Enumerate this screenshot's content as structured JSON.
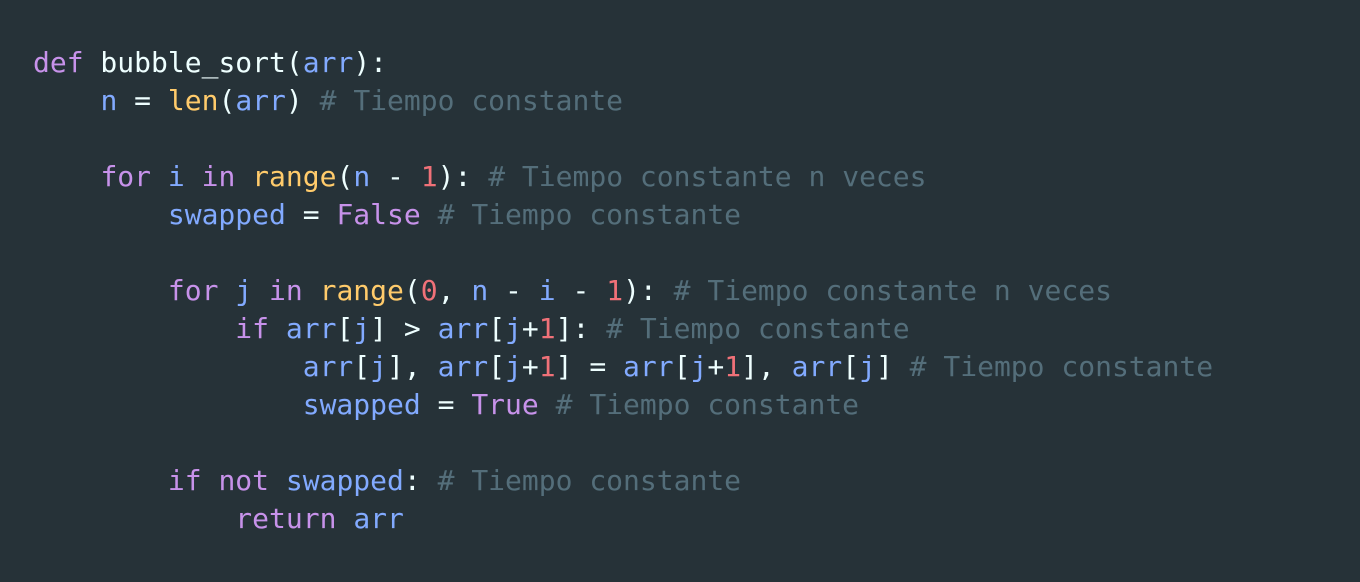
{
  "colors": {
    "background": "#263238",
    "plain": "#eeffff",
    "keyword": "#c792ea",
    "variable": "#82aaff",
    "builtin": "#ffcb6b",
    "number": "#f07178",
    "comment": "#546e7a"
  },
  "code": {
    "language": "python",
    "lines": [
      [
        {
          "t": "def",
          "k": "keyword"
        },
        {
          "t": " bubble_sort(",
          "k": "plain"
        },
        {
          "t": "arr",
          "k": "variable"
        },
        {
          "t": "):",
          "k": "plain"
        }
      ],
      [
        {
          "t": "    ",
          "k": "plain"
        },
        {
          "t": "n",
          "k": "variable"
        },
        {
          "t": " = ",
          "k": "plain"
        },
        {
          "t": "len",
          "k": "builtin"
        },
        {
          "t": "(",
          "k": "plain"
        },
        {
          "t": "arr",
          "k": "variable"
        },
        {
          "t": ") ",
          "k": "plain"
        },
        {
          "t": "# Tiempo constante",
          "k": "comment"
        }
      ],
      [],
      [
        {
          "t": "    ",
          "k": "plain"
        },
        {
          "t": "for",
          "k": "keyword"
        },
        {
          "t": " ",
          "k": "plain"
        },
        {
          "t": "i",
          "k": "variable"
        },
        {
          "t": " ",
          "k": "plain"
        },
        {
          "t": "in",
          "k": "keyword"
        },
        {
          "t": " ",
          "k": "plain"
        },
        {
          "t": "range",
          "k": "builtin"
        },
        {
          "t": "(",
          "k": "plain"
        },
        {
          "t": "n",
          "k": "variable"
        },
        {
          "t": " - ",
          "k": "plain"
        },
        {
          "t": "1",
          "k": "number"
        },
        {
          "t": "): ",
          "k": "plain"
        },
        {
          "t": "# Tiempo constante n veces",
          "k": "comment"
        }
      ],
      [
        {
          "t": "        ",
          "k": "plain"
        },
        {
          "t": "swapped",
          "k": "variable"
        },
        {
          "t": " = ",
          "k": "plain"
        },
        {
          "t": "False",
          "k": "keyword"
        },
        {
          "t": " ",
          "k": "plain"
        },
        {
          "t": "# Tiempo constante",
          "k": "comment"
        }
      ],
      [],
      [
        {
          "t": "        ",
          "k": "plain"
        },
        {
          "t": "for",
          "k": "keyword"
        },
        {
          "t": " ",
          "k": "plain"
        },
        {
          "t": "j",
          "k": "variable"
        },
        {
          "t": " ",
          "k": "plain"
        },
        {
          "t": "in",
          "k": "keyword"
        },
        {
          "t": " ",
          "k": "plain"
        },
        {
          "t": "range",
          "k": "builtin"
        },
        {
          "t": "(",
          "k": "plain"
        },
        {
          "t": "0",
          "k": "number"
        },
        {
          "t": ", ",
          "k": "plain"
        },
        {
          "t": "n",
          "k": "variable"
        },
        {
          "t": " - ",
          "k": "plain"
        },
        {
          "t": "i",
          "k": "variable"
        },
        {
          "t": " - ",
          "k": "plain"
        },
        {
          "t": "1",
          "k": "number"
        },
        {
          "t": "): ",
          "k": "plain"
        },
        {
          "t": "# Tiempo constante n veces",
          "k": "comment"
        }
      ],
      [
        {
          "t": "            ",
          "k": "plain"
        },
        {
          "t": "if",
          "k": "keyword"
        },
        {
          "t": " ",
          "k": "plain"
        },
        {
          "t": "arr",
          "k": "variable"
        },
        {
          "t": "[",
          "k": "plain"
        },
        {
          "t": "j",
          "k": "variable"
        },
        {
          "t": "] > ",
          "k": "plain"
        },
        {
          "t": "arr",
          "k": "variable"
        },
        {
          "t": "[",
          "k": "plain"
        },
        {
          "t": "j",
          "k": "variable"
        },
        {
          "t": "+",
          "k": "plain"
        },
        {
          "t": "1",
          "k": "number"
        },
        {
          "t": "]: ",
          "k": "plain"
        },
        {
          "t": "# Tiempo constante",
          "k": "comment"
        }
      ],
      [
        {
          "t": "                ",
          "k": "plain"
        },
        {
          "t": "arr",
          "k": "variable"
        },
        {
          "t": "[",
          "k": "plain"
        },
        {
          "t": "j",
          "k": "variable"
        },
        {
          "t": "], ",
          "k": "plain"
        },
        {
          "t": "arr",
          "k": "variable"
        },
        {
          "t": "[",
          "k": "plain"
        },
        {
          "t": "j",
          "k": "variable"
        },
        {
          "t": "+",
          "k": "plain"
        },
        {
          "t": "1",
          "k": "number"
        },
        {
          "t": "] = ",
          "k": "plain"
        },
        {
          "t": "arr",
          "k": "variable"
        },
        {
          "t": "[",
          "k": "plain"
        },
        {
          "t": "j",
          "k": "variable"
        },
        {
          "t": "+",
          "k": "plain"
        },
        {
          "t": "1",
          "k": "number"
        },
        {
          "t": "], ",
          "k": "plain"
        },
        {
          "t": "arr",
          "k": "variable"
        },
        {
          "t": "[",
          "k": "plain"
        },
        {
          "t": "j",
          "k": "variable"
        },
        {
          "t": "] ",
          "k": "plain"
        },
        {
          "t": "# Tiempo constante",
          "k": "comment"
        }
      ],
      [
        {
          "t": "                ",
          "k": "plain"
        },
        {
          "t": "swapped",
          "k": "variable"
        },
        {
          "t": " = ",
          "k": "plain"
        },
        {
          "t": "True",
          "k": "keyword"
        },
        {
          "t": " ",
          "k": "plain"
        },
        {
          "t": "# Tiempo constante",
          "k": "comment"
        }
      ],
      [],
      [
        {
          "t": "        ",
          "k": "plain"
        },
        {
          "t": "if",
          "k": "keyword"
        },
        {
          "t": " ",
          "k": "plain"
        },
        {
          "t": "not",
          "k": "keyword"
        },
        {
          "t": " ",
          "k": "plain"
        },
        {
          "t": "swapped",
          "k": "variable"
        },
        {
          "t": ": ",
          "k": "plain"
        },
        {
          "t": "# Tiempo constante",
          "k": "comment"
        }
      ],
      [
        {
          "t": "            ",
          "k": "plain"
        },
        {
          "t": "return",
          "k": "keyword"
        },
        {
          "t": " ",
          "k": "plain"
        },
        {
          "t": "arr",
          "k": "variable"
        }
      ]
    ]
  }
}
